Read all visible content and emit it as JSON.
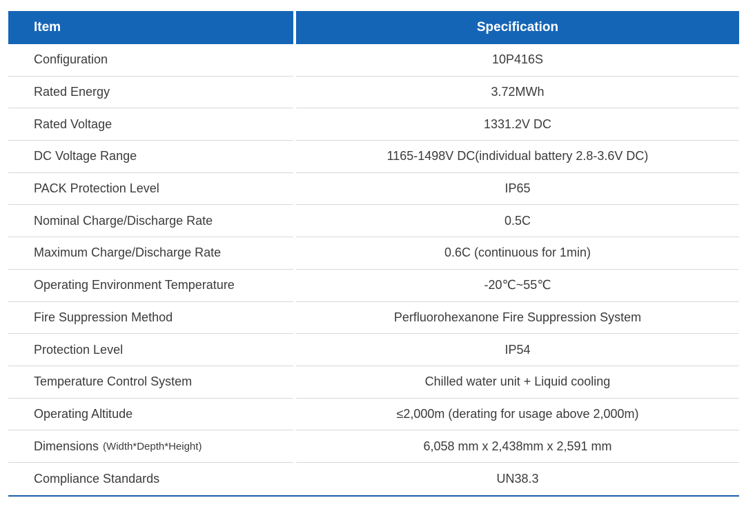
{
  "table": {
    "header": {
      "item": "Item",
      "specification": "Specification"
    },
    "rows": [
      {
        "item": "Configuration",
        "note": "",
        "spec": "10P416S"
      },
      {
        "item": "Rated Energy",
        "note": "",
        "spec": "3.72MWh"
      },
      {
        "item": "Rated Voltage",
        "note": "",
        "spec": "1331.2V DC"
      },
      {
        "item": "DC Voltage Range",
        "note": "",
        "spec": "1165-1498V DC(individual battery 2.8-3.6V DC)"
      },
      {
        "item": "PACK Protection Level",
        "note": "",
        "spec": "IP65"
      },
      {
        "item": "Nominal Charge/Discharge Rate",
        "note": "",
        "spec": "0.5C"
      },
      {
        "item": "Maximum Charge/Discharge Rate",
        "note": "",
        "spec": "0.6C (continuous for 1min)"
      },
      {
        "item": "Operating Environment Temperature",
        "note": "",
        "spec": "-20℃~55℃"
      },
      {
        "item": "Fire Suppression Method",
        "note": "",
        "spec": "Perfluorohexanone Fire Suppression System"
      },
      {
        "item": "Protection Level",
        "note": "",
        "spec": "IP54"
      },
      {
        "item": "Temperature Control System",
        "note": "",
        "spec": "Chilled water unit + Liquid cooling"
      },
      {
        "item": "Operating Altitude",
        "note": "",
        "spec": "≤2,000m (derating for usage above 2,000m)"
      },
      {
        "item": "Dimensions",
        "note": "(Width*Depth*Height)",
        "spec": "6,058 mm x 2,438mm x 2,591 mm"
      },
      {
        "item": "Compliance Standards",
        "note": "",
        "spec": "UN38.3"
      }
    ]
  },
  "colors": {
    "header_bg": "#1565b7",
    "header_text": "#ffffff",
    "row_divider": "#d8d8d8",
    "bottom_border": "#1a5ea8"
  }
}
